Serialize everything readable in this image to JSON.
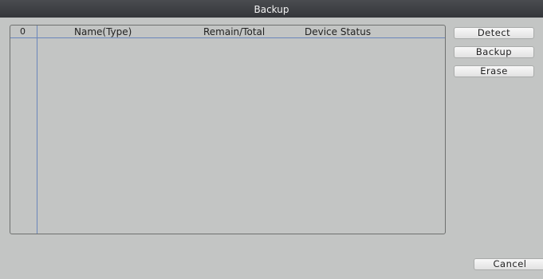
{
  "window": {
    "title": "Backup"
  },
  "table": {
    "count": "0",
    "columns": [
      "Name(Type)",
      "Remain/Total",
      "Device Status"
    ],
    "rows": []
  },
  "buttons": {
    "detect": "Detect",
    "backup": "Backup",
    "erase": "Erase",
    "cancel": "Cancel"
  },
  "colors": {
    "titlebar": "#3b3d41",
    "background": "#c3c5c4",
    "grid_line": "#6a86bb"
  }
}
